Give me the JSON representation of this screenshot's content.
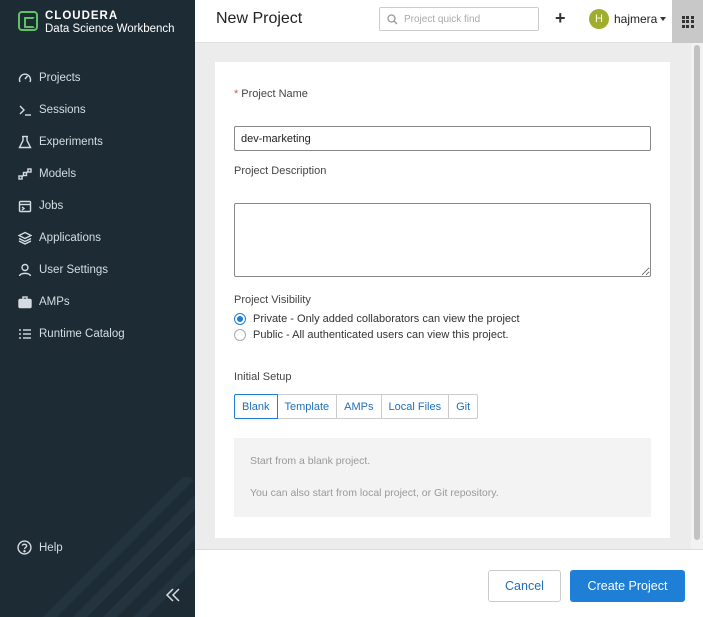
{
  "brand": {
    "line1": "CLOUDERA",
    "line2": "Data Science Workbench",
    "accent_color": "#5ec461"
  },
  "sidebar": {
    "items": [
      {
        "label": "Projects",
        "icon": "gauge-icon"
      },
      {
        "label": "Sessions",
        "icon": "terminal-icon"
      },
      {
        "label": "Experiments",
        "icon": "flask-icon"
      },
      {
        "label": "Models",
        "icon": "network-icon"
      },
      {
        "label": "Jobs",
        "icon": "calendar-icon"
      },
      {
        "label": "Applications",
        "icon": "layers-icon"
      },
      {
        "label": "User Settings",
        "icon": "user-icon"
      },
      {
        "label": "AMPs",
        "icon": "briefcase-icon"
      },
      {
        "label": "Runtime Catalog",
        "icon": "list-icon"
      }
    ],
    "help_label": "Help",
    "collapse_icon": "double-chevron-left-icon"
  },
  "header": {
    "title": "New Project",
    "search_placeholder": "Project quick find",
    "add_icon": "plus-icon",
    "user": {
      "initial": "H",
      "name": "hajmera"
    },
    "apps_icon": "grid-icon"
  },
  "form": {
    "project_name": {
      "required_mark": "*",
      "label": "Project Name",
      "value": "dev-marketing"
    },
    "project_description": {
      "label": "Project Description",
      "value": ""
    },
    "visibility": {
      "label": "Project Visibility",
      "options": [
        {
          "label": "Private - Only added collaborators can view the project",
          "selected": true
        },
        {
          "label": "Public - All authenticated users can view this project.",
          "selected": false
        }
      ]
    },
    "initial_setup": {
      "label": "Initial Setup",
      "tabs": [
        "Blank",
        "Template",
        "AMPs",
        "Local Files",
        "Git"
      ],
      "active_tab": "Blank",
      "info_line1": "Start from a blank project.",
      "info_line2": "You can also start from local project, or Git repository."
    }
  },
  "footer": {
    "cancel_label": "Cancel",
    "create_label": "Create Project"
  },
  "colors": {
    "sidebar_bg": "#1d2b35",
    "primary": "#1f7ed6",
    "avatar_bg": "#9fae2c",
    "required": "#d9534f"
  }
}
